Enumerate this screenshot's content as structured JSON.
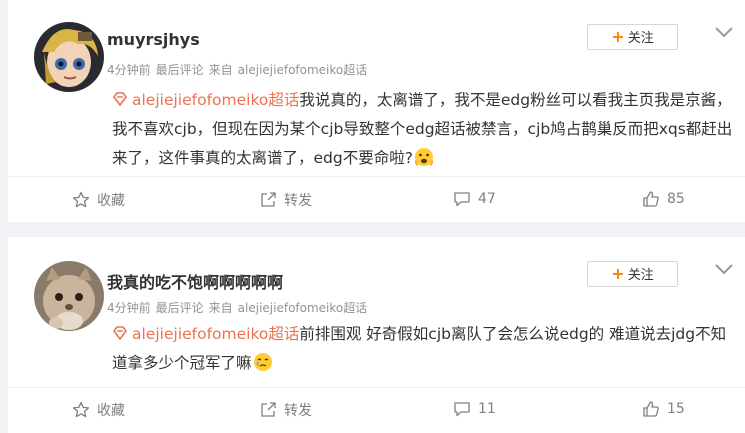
{
  "posts": [
    {
      "username": "muyrsjhys",
      "time": "4分钟前",
      "tag": "最后评论",
      "source_prefix": "来自",
      "source": "alejiejiefofomeiko超话",
      "follow_label": "关注",
      "topic": "alejiejiefofomeiko超话",
      "text": "我说真的，太离谱了，我不是edg粉丝可以看我主页我是京酱，我不喜欢cjb，但现在因为某个cjb导致整个edg超话被禁言，cjb鸠占鹊巢反而把xqs都赶出来了，这件事真的太离谱了，edg不要命啦?",
      "emoji": "scared-face-emoji",
      "fav_label": "收藏",
      "fwd_label": "转发",
      "comments": "47",
      "likes": "85"
    },
    {
      "username": "我真的吃不饱啊啊啊啊啊",
      "time": "4分钟前",
      "tag": "最后评论",
      "source_prefix": "来自",
      "source": "alejiejiefofomeiko超话",
      "follow_label": "关注",
      "topic": "alejiejiefofomeiko超话",
      "text": "前排围观 好奇假如cjb离队了会怎么说edg的 难道说去jdg不知道拿多少个冠军了嘛",
      "emoji": "teary-face-emoji",
      "fav_label": "收藏",
      "fwd_label": "转发",
      "comments": "11",
      "likes": "15"
    }
  ],
  "colors": {
    "page_bg": "#f1f2f5",
    "topic": "#eb7350",
    "meta": "#939393",
    "accent": "#ff8200"
  }
}
